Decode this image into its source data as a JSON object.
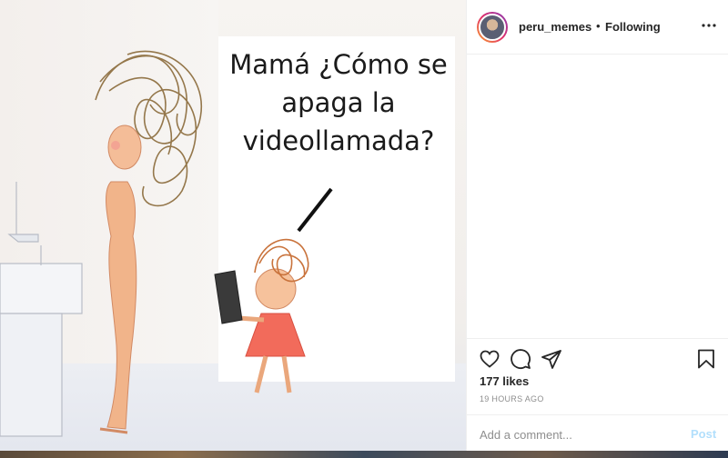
{
  "media": {
    "caption": "Mamá ¿Cómo se\napaga la\nvideollamada?"
  },
  "header": {
    "username": "peru_memes",
    "separator": "•",
    "follow_status": "Following",
    "icons": {
      "more": "more-horizontal-icon"
    }
  },
  "actions": {
    "icons": [
      "heart-icon",
      "comment-icon",
      "share-icon",
      "bookmark-icon"
    ]
  },
  "stats": {
    "likes": "177 likes",
    "timestamp": "19 HOURS AGO"
  },
  "comment": {
    "placeholder": "Add a comment...",
    "post_label": "Post"
  },
  "colors": {
    "post_button_disabled": "#b2dffc",
    "text": "#262626",
    "muted": "#8e8e8e",
    "dress": "#f26b5b"
  }
}
